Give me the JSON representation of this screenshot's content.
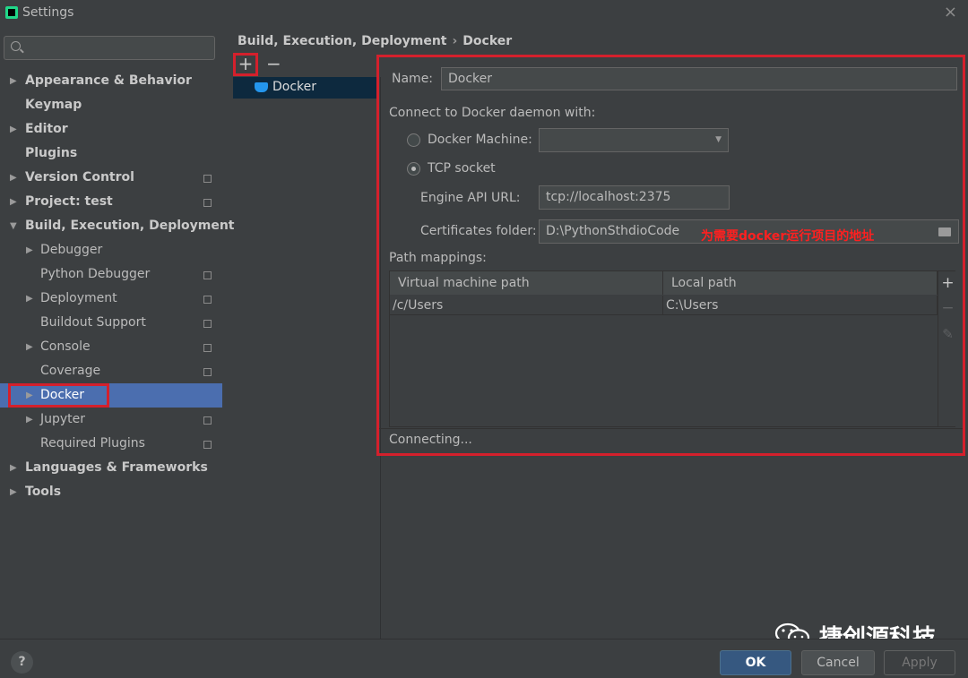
{
  "window": {
    "title": "Settings"
  },
  "sidebar": {
    "items": [
      {
        "label": "Appearance & Behavior",
        "arrow": "▶",
        "level": 0,
        "bold": true,
        "page_icon": false,
        "selected": false
      },
      {
        "label": "Keymap",
        "arrow": "",
        "level": 0,
        "bold": true,
        "page_icon": false,
        "selected": false
      },
      {
        "label": "Editor",
        "arrow": "▶",
        "level": 0,
        "bold": true,
        "page_icon": false,
        "selected": false
      },
      {
        "label": "Plugins",
        "arrow": "",
        "level": 0,
        "bold": true,
        "page_icon": false,
        "selected": false
      },
      {
        "label": "Version Control",
        "arrow": "▶",
        "level": 0,
        "bold": true,
        "page_icon": true,
        "selected": false
      },
      {
        "label": "Project: test",
        "arrow": "▶",
        "level": 0,
        "bold": true,
        "page_icon": true,
        "selected": false
      },
      {
        "label": "Build, Execution, Deployment",
        "arrow": "▼",
        "level": 0,
        "bold": true,
        "page_icon": false,
        "selected": false
      },
      {
        "label": "Debugger",
        "arrow": "▶",
        "level": 1,
        "bold": false,
        "page_icon": false,
        "selected": false
      },
      {
        "label": "Python Debugger",
        "arrow": "",
        "level": 1,
        "bold": false,
        "page_icon": true,
        "selected": false
      },
      {
        "label": "Deployment",
        "arrow": "▶",
        "level": 1,
        "bold": false,
        "page_icon": true,
        "selected": false
      },
      {
        "label": "Buildout Support",
        "arrow": "",
        "level": 1,
        "bold": false,
        "page_icon": true,
        "selected": false
      },
      {
        "label": "Console",
        "arrow": "▶",
        "level": 1,
        "bold": false,
        "page_icon": true,
        "selected": false
      },
      {
        "label": "Coverage",
        "arrow": "",
        "level": 1,
        "bold": false,
        "page_icon": true,
        "selected": false
      },
      {
        "label": "Docker",
        "arrow": "▶",
        "level": 1,
        "bold": false,
        "page_icon": false,
        "selected": true
      },
      {
        "label": "Jupyter",
        "arrow": "▶",
        "level": 1,
        "bold": false,
        "page_icon": true,
        "selected": false
      },
      {
        "label": "Required Plugins",
        "arrow": "",
        "level": 1,
        "bold": false,
        "page_icon": true,
        "selected": false
      },
      {
        "label": "Languages & Frameworks",
        "arrow": "▶",
        "level": 0,
        "bold": true,
        "page_icon": false,
        "selected": false
      },
      {
        "label": "Tools",
        "arrow": "▶",
        "level": 0,
        "bold": true,
        "page_icon": false,
        "selected": false
      }
    ]
  },
  "breadcrumb": {
    "parent": "Build, Execution, Deployment",
    "separator": "›",
    "current": "Docker"
  },
  "toolbar": {
    "add": "+",
    "remove": "−"
  },
  "docker_list": {
    "entry": "Docker"
  },
  "form": {
    "name_label": "Name:",
    "name_value": "Docker",
    "connect_label": "Connect to Docker daemon with:",
    "docker_machine_label": "Docker Machine:",
    "docker_machine_value": "",
    "tcp_label": "TCP socket",
    "connection_mode": "TCP socket",
    "engine_url_label": "Engine API URL:",
    "engine_url_value": "tcp://localhost:2375",
    "cert_label": "Certificates folder:",
    "cert_value": "D:\\PythonSthdioCode",
    "annotation": "为需要docker运行项目的地址",
    "path_mappings_label": "Path mappings:",
    "columns": [
      "Virtual machine path",
      "Local path"
    ],
    "rows": [
      {
        "vm": "/c/Users",
        "local": "C:\\Users"
      }
    ],
    "status": "Connecting..."
  },
  "table_tools": {
    "add": "+",
    "remove": "−",
    "edit": "✎"
  },
  "buttons": {
    "help": "?",
    "ok": "OK",
    "cancel": "Cancel",
    "apply": "Apply"
  },
  "watermark": {
    "text": "捷创源科技"
  },
  "colors": {
    "highlight": "#d4202c",
    "selection": "#4b6eaf",
    "ok_button": "#365880",
    "annotation": "#ff2020"
  }
}
